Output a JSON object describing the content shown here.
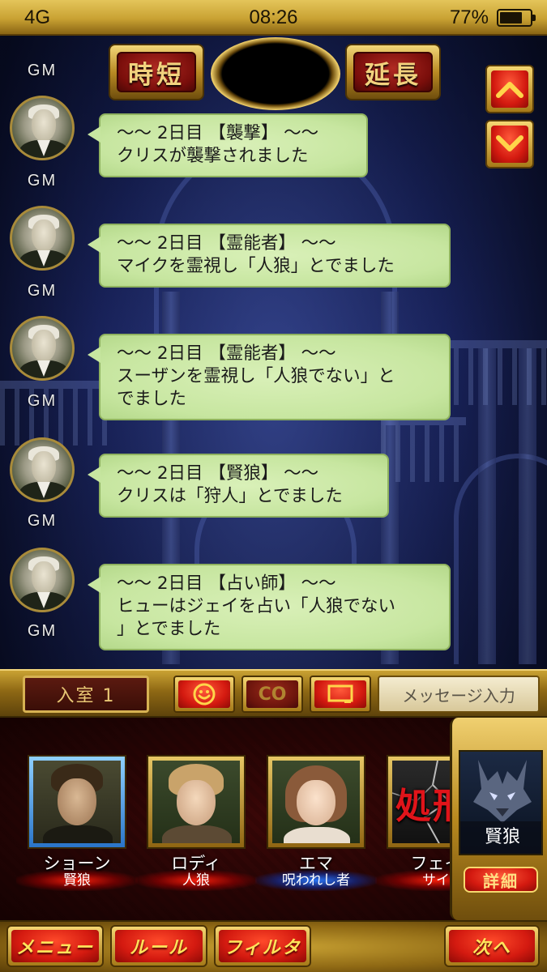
{
  "status_bar": {
    "signal": "4G",
    "time": "08:26",
    "battery_pct": "77%",
    "battery_level": 0.77
  },
  "top": {
    "shorten_label": "時短",
    "extend_label": "延長"
  },
  "scroll": {
    "up_icon": "chevron-up-icon",
    "down_icon": "chevron-down-icon"
  },
  "chat": {
    "partial_sender": "GM",
    "messages": [
      {
        "sender": "GM",
        "text": "〜〜 2日目 【襲撃】 〜〜\nクリスが襲撃されました"
      },
      {
        "sender": "GM",
        "text": "〜〜 2日目 【霊能者】 〜〜\nマイクを霊視し「人狼」とでました"
      },
      {
        "sender": "GM",
        "text": "〜〜 2日目 【霊能者】 〜〜\nスーザンを霊視し「人狼でない」と\nでました"
      },
      {
        "sender": "GM",
        "text": "〜〜 2日目 【賢狼】 〜〜\nクリスは「狩人」とでました"
      },
      {
        "sender": "GM",
        "text": "〜〜 2日目 【占い師】 〜〜\nヒューはジェイを占い「人狼でない\n」とでました"
      }
    ]
  },
  "input_bar": {
    "room_label": "入室 1",
    "smiley_icon": "smiley-icon",
    "co_label": "CO",
    "window_icon": "speech-window-icon",
    "message_placeholder": "メッセージ入力"
  },
  "players": [
    {
      "name": "ショーン",
      "role": "賢狼",
      "role_glow": "red",
      "selected": true
    },
    {
      "name": "ロディ",
      "role": "人狼",
      "role_glow": "red",
      "selected": false
    },
    {
      "name": "エマ",
      "role": "呪われし者",
      "role_glow": "blue",
      "selected": false
    },
    {
      "name": "フェイ",
      "role": "サイ",
      "role_glow": "red",
      "selected": false,
      "overlay": "処刑"
    }
  ],
  "side_card": {
    "role_name": "賢狼",
    "detail_label": "詳細"
  },
  "bottom_nav": {
    "menu_label": "メニュー",
    "rules_label": "ルール",
    "filter_label": "フィルタ",
    "next_label": "次へ"
  },
  "colors": {
    "gold": "#c9a233",
    "bubble_green": "#c7e6a0",
    "button_red": "#d41a10",
    "role_red_glow": "#ff1e0a",
    "role_blue_glow": "#2878ff"
  }
}
